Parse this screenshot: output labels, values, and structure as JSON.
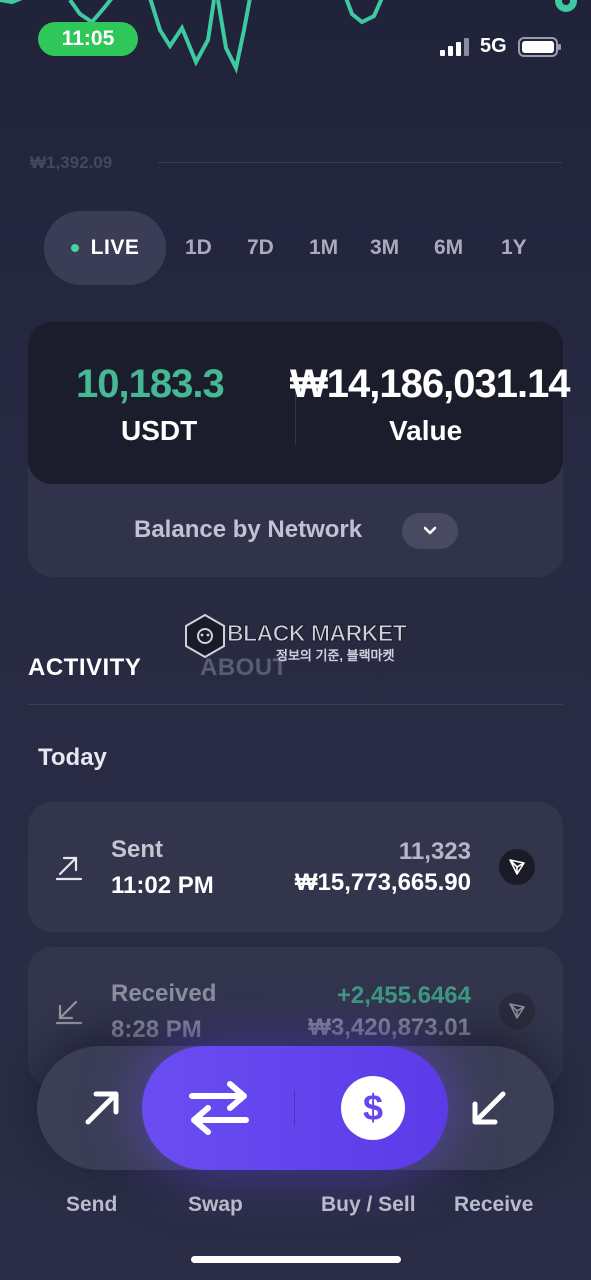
{
  "status_bar": {
    "time": "11:05",
    "network": "5G"
  },
  "chart": {
    "reference_price": "₩1,392.09"
  },
  "range_tabs": {
    "live": "LIVE",
    "items": [
      "1D",
      "7D",
      "1M",
      "3M",
      "6M",
      "1Y"
    ],
    "selected": "LIVE",
    "live_dot_color": "#45d3a3"
  },
  "balance": {
    "amount": "10,183.3",
    "unit": "USDT",
    "value": "₩14,186,031.14",
    "value_label": "Value",
    "network_label": "Balance by Network",
    "amount_color": "#45b894"
  },
  "watermark": {
    "title": "BLACK MARKET",
    "subtitle": "정보의 기준, 블랙마켓",
    "badge_text": "BLACK MARKET"
  },
  "tabs": {
    "activity": "ACTIVITY",
    "about": "ABOUT",
    "selected": "ACTIVITY"
  },
  "activity": {
    "section": "Today",
    "transactions": [
      {
        "type": "Sent",
        "time": "11:02 PM",
        "amount": "11,323",
        "fiat": "₩15,773,665.90",
        "direction_icon": "arrow-up-right-icon",
        "network_icon": "tron-icon"
      },
      {
        "type": "Received",
        "time": "8:28 PM",
        "amount": "+2,455.6464",
        "fiat": "₩3,420,873.01",
        "direction_icon": "arrow-down-left-icon",
        "network_icon": "tron-icon",
        "amount_color": "#45b894"
      }
    ]
  },
  "actions": {
    "send": "Send",
    "swap": "Swap",
    "buy_sell": "Buy / Sell",
    "receive": "Receive",
    "dollar_symbol": "$",
    "accent": "#6a4df2"
  }
}
